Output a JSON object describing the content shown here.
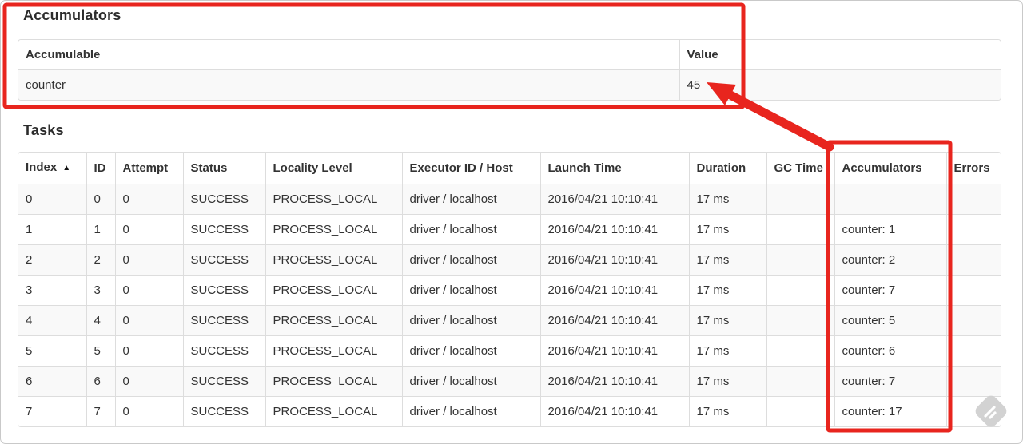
{
  "accumulators_section": {
    "title": "Accumulators",
    "table": {
      "headers": {
        "accumulable": "Accumulable",
        "value": "Value"
      },
      "rows": [
        {
          "accumulable": "counter",
          "value": "45"
        }
      ]
    }
  },
  "tasks_section": {
    "title": "Tasks",
    "table": {
      "headers": [
        "Index",
        "ID",
        "Attempt",
        "Status",
        "Locality Level",
        "Executor ID / Host",
        "Launch Time",
        "Duration",
        "GC Time",
        "Accumulators",
        "Errors"
      ],
      "sort_icon": "▲",
      "rows": [
        {
          "index": "0",
          "id": "0",
          "attempt": "0",
          "status": "SUCCESS",
          "locality": "PROCESS_LOCAL",
          "executor": "driver / localhost",
          "launch": "2016/04/21 10:10:41",
          "duration": "17 ms",
          "gc_time": "",
          "accumulators": "",
          "errors": ""
        },
        {
          "index": "1",
          "id": "1",
          "attempt": "0",
          "status": "SUCCESS",
          "locality": "PROCESS_LOCAL",
          "executor": "driver / localhost",
          "launch": "2016/04/21 10:10:41",
          "duration": "17 ms",
          "gc_time": "",
          "accumulators": "counter: 1",
          "errors": ""
        },
        {
          "index": "2",
          "id": "2",
          "attempt": "0",
          "status": "SUCCESS",
          "locality": "PROCESS_LOCAL",
          "executor": "driver / localhost",
          "launch": "2016/04/21 10:10:41",
          "duration": "17 ms",
          "gc_time": "",
          "accumulators": "counter: 2",
          "errors": ""
        },
        {
          "index": "3",
          "id": "3",
          "attempt": "0",
          "status": "SUCCESS",
          "locality": "PROCESS_LOCAL",
          "executor": "driver / localhost",
          "launch": "2016/04/21 10:10:41",
          "duration": "17 ms",
          "gc_time": "",
          "accumulators": "counter: 7",
          "errors": ""
        },
        {
          "index": "4",
          "id": "4",
          "attempt": "0",
          "status": "SUCCESS",
          "locality": "PROCESS_LOCAL",
          "executor": "driver / localhost",
          "launch": "2016/04/21 10:10:41",
          "duration": "17 ms",
          "gc_time": "",
          "accumulators": "counter: 5",
          "errors": ""
        },
        {
          "index": "5",
          "id": "5",
          "attempt": "0",
          "status": "SUCCESS",
          "locality": "PROCESS_LOCAL",
          "executor": "driver / localhost",
          "launch": "2016/04/21 10:10:41",
          "duration": "17 ms",
          "gc_time": "",
          "accumulators": "counter: 6",
          "errors": ""
        },
        {
          "index": "6",
          "id": "6",
          "attempt": "0",
          "status": "SUCCESS",
          "locality": "PROCESS_LOCAL",
          "executor": "driver / localhost",
          "launch": "2016/04/21 10:10:41",
          "duration": "17 ms",
          "gc_time": "",
          "accumulators": "counter: 7",
          "errors": ""
        },
        {
          "index": "7",
          "id": "7",
          "attempt": "0",
          "status": "SUCCESS",
          "locality": "PROCESS_LOCAL",
          "executor": "driver / localhost",
          "launch": "2016/04/21 10:10:41",
          "duration": "17 ms",
          "gc_time": "",
          "accumulators": "counter: 17",
          "errors": ""
        }
      ]
    }
  },
  "annotations": {
    "color": "#e8251e",
    "shapes": [
      "box-around-accumulators-section",
      "box-around-accumulators-column",
      "arrow-pointing-at-value-45"
    ]
  },
  "watermark": {
    "name": "screenshot-tool-badge",
    "color": "#cfcfcf"
  }
}
